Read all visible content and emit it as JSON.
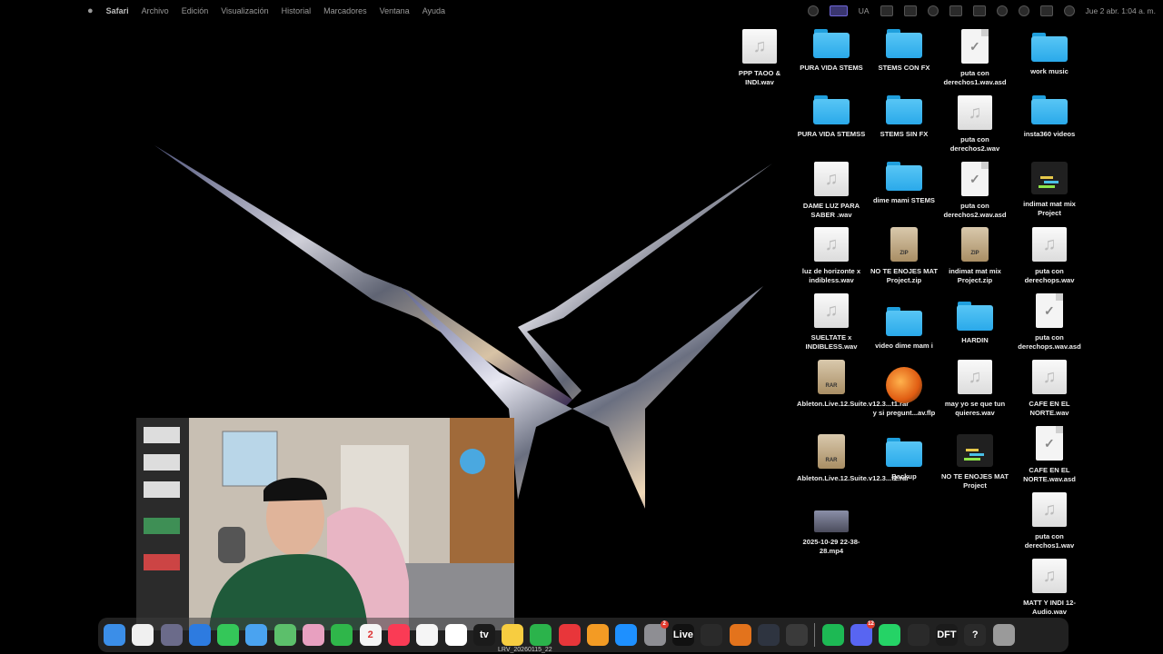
{
  "menubar": {
    "app_name": "Safari",
    "menus": [
      "Archivo",
      "Edición",
      "Visualización",
      "Historial",
      "Marcadores",
      "Ventana",
      "Ayuda"
    ],
    "status_text": "UA",
    "clock": "Jue 2 abr. 1:04 a. m."
  },
  "desktop": {
    "icons": [
      {
        "label": "PPP TAOO & INDI.wav",
        "kind": "audio",
        "icon": "audio-file-icon"
      },
      {
        "label": "PURA VIDA STEMS",
        "kind": "folder",
        "icon": "folder-icon"
      },
      {
        "label": "STEMS CON FX",
        "kind": "folder",
        "icon": "folder-icon"
      },
      {
        "label": "puta con derechos1.wav.asd",
        "kind": "asd",
        "icon": "document-icon"
      },
      {
        "label": "work music",
        "kind": "folder",
        "icon": "folder-icon"
      },
      {
        "label": "PURA VIDA STEMSS",
        "kind": "folder",
        "icon": "folder-icon"
      },
      {
        "label": "STEMS SIN FX",
        "kind": "folder",
        "icon": "folder-icon"
      },
      {
        "label": "puta con derechos2.wav",
        "kind": "audio",
        "icon": "audio-file-icon"
      },
      {
        "label": "insta360 videos",
        "kind": "folder",
        "icon": "folder-icon"
      },
      {
        "label": "DAME LUZ PARA SABER .wav",
        "kind": "audio",
        "icon": "audio-file-icon"
      },
      {
        "label": "dime mami STEMS",
        "kind": "folder",
        "icon": "folder-icon"
      },
      {
        "label": "puta con derechos2.wav.asd",
        "kind": "asd",
        "icon": "document-icon"
      },
      {
        "label": "indimat mat mix Project",
        "kind": "project",
        "icon": "ableton-project-icon"
      },
      {
        "label": "luz de horizonte x indibless.wav",
        "kind": "audio",
        "icon": "audio-file-icon"
      },
      {
        "label": "NO TE ENOJES MAT Project.zip",
        "kind": "zip",
        "icon": "zip-archive-icon"
      },
      {
        "label": "indimat mat mix Project.zip",
        "kind": "zip",
        "icon": "zip-archive-icon"
      },
      {
        "label": "puta con derechops.wav",
        "kind": "audio",
        "icon": "audio-file-icon"
      },
      {
        "label": "SUELTATE x INDIBLESS.wav",
        "kind": "audio",
        "icon": "audio-file-icon"
      },
      {
        "label": "video dime mam i",
        "kind": "folder",
        "icon": "folder-icon"
      },
      {
        "label": "HARDIN",
        "kind": "folder",
        "icon": "folder-icon"
      },
      {
        "label": "puta con derechops.wav.asd",
        "kind": "asd",
        "icon": "document-icon"
      },
      {
        "label": "Ableton.Live.12.Suite.v12.3...t1.rar",
        "kind": "rar",
        "icon": "rar-archive-icon"
      },
      {
        "label": "y si pregunt...av.flp",
        "kind": "flp",
        "icon": "fl-studio-file-icon"
      },
      {
        "label": "may yo se que tun quieres.wav",
        "kind": "audio",
        "icon": "audio-file-icon"
      },
      {
        "label": "CAFE EN EL NORTE.wav",
        "kind": "audio",
        "icon": "audio-file-icon"
      },
      {
        "label": "Ableton.Live.12.Suite.v12.3...t2.rar",
        "kind": "rar",
        "icon": "rar-archive-icon"
      },
      {
        "label": "Backup",
        "kind": "folder",
        "icon": "folder-icon"
      },
      {
        "label": "NO TE ENOJES MAT Project",
        "kind": "project",
        "icon": "ableton-project-icon"
      },
      {
        "label": "CAFE EN EL NORTE.wav.asd",
        "kind": "asd",
        "icon": "document-icon"
      },
      {
        "label": "2025-10-29 22-38-28.mp4",
        "kind": "video",
        "icon": "video-thumbnail-icon"
      },
      {
        "label": "puta con derechos1.wav",
        "kind": "audio",
        "icon": "audio-file-icon"
      },
      {
        "label": "MATT Y INDI 12-Audio.wav",
        "kind": "audio",
        "icon": "audio-file-icon"
      }
    ]
  },
  "dock": {
    "apps": [
      {
        "name": "finder-icon",
        "color": "#3b8ee8",
        "text": ""
      },
      {
        "name": "notes-icon",
        "color": "#f0f0f0",
        "text": ""
      },
      {
        "name": "launchpad-icon",
        "color": "#6b6b8a",
        "text": ""
      },
      {
        "name": "safari-icon",
        "color": "#2d7be0",
        "text": ""
      },
      {
        "name": "messages-icon",
        "color": "#34c759",
        "text": ""
      },
      {
        "name": "mail-icon",
        "color": "#4aa3f0",
        "text": ""
      },
      {
        "name": "maps-icon",
        "color": "#5cbf6b",
        "text": ""
      },
      {
        "name": "photos-icon",
        "color": "#e8a0c0",
        "text": ""
      },
      {
        "name": "facetime-icon",
        "color": "#2fb64a",
        "text": ""
      },
      {
        "name": "calendar-icon",
        "color": "#f5f5f5",
        "text": "2"
      },
      {
        "name": "music-icon",
        "color": "#fa3b55",
        "text": ""
      },
      {
        "name": "reminders-icon",
        "color": "#f5f5f5",
        "text": ""
      },
      {
        "name": "freeform-icon",
        "color": "#ffffff",
        "text": ""
      },
      {
        "name": "apple-tv-icon",
        "color": "#1b1b1b",
        "text": "tv"
      },
      {
        "name": "notes-yellow-icon",
        "color": "#f7cd40",
        "text": ""
      },
      {
        "name": "numbers-icon",
        "color": "#2bb34b",
        "text": ""
      },
      {
        "name": "keynote-icon",
        "color": "#e8363a",
        "text": ""
      },
      {
        "name": "pages-icon",
        "color": "#f39b24",
        "text": ""
      },
      {
        "name": "app-store-icon",
        "color": "#1e90ff",
        "text": ""
      },
      {
        "name": "system-settings-icon",
        "color": "#8e8e93",
        "text": "",
        "badge": "2"
      },
      {
        "name": "ableton-live-icon",
        "color": "#111111",
        "text": "Live"
      },
      {
        "name": "unity-hub-icon",
        "color": "#2a2a2a",
        "text": ""
      },
      {
        "name": "fl-studio-icon",
        "color": "#e3731c",
        "text": ""
      },
      {
        "name": "mixer-icon",
        "color": "#2e3440",
        "text": ""
      },
      {
        "name": "speed-icon",
        "color": "#3a3a3a",
        "text": ""
      },
      {
        "name": "spotify-icon",
        "color": "#1db954",
        "text": ""
      },
      {
        "name": "discord-icon",
        "color": "#5865f2",
        "text": "",
        "badge": "12"
      },
      {
        "name": "whatsapp-icon",
        "color": "#25d366",
        "text": ""
      },
      {
        "name": "activity-monitor-icon",
        "color": "#2a2a2a",
        "text": ""
      },
      {
        "name": "dft-app-icon",
        "color": "#1b1b1b",
        "text": "DFT"
      },
      {
        "name": "help-icon",
        "color": "#2a2a2a",
        "text": "?"
      },
      {
        "name": "trash-icon",
        "color": "#9a9a9a",
        "text": ""
      }
    ],
    "running_label": "LRV_20260115_22"
  }
}
